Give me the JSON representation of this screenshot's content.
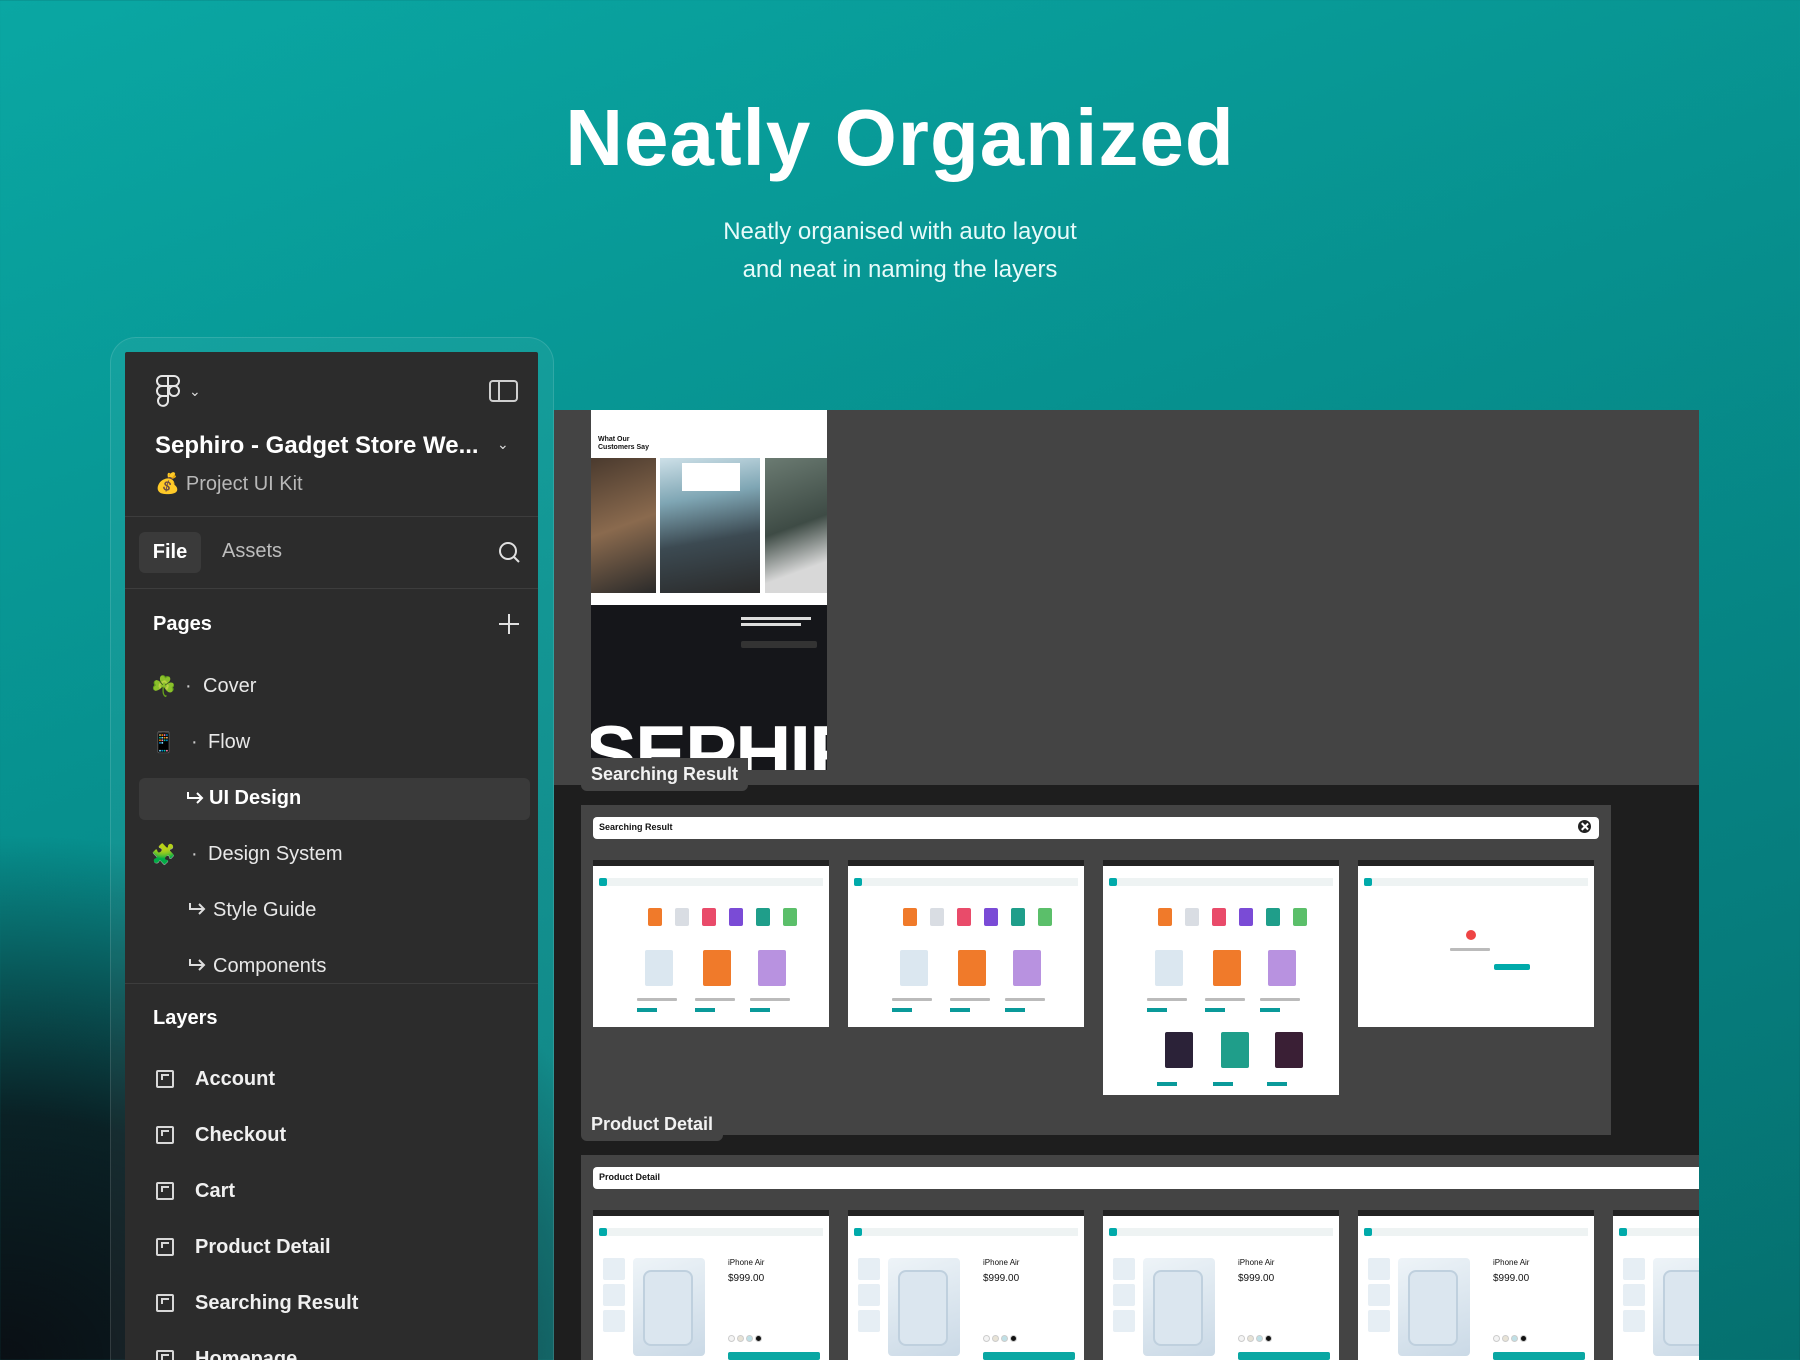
{
  "hero": {
    "title": "Neatly Organized",
    "subtitle_line1": "Neatly organised with auto layout",
    "subtitle_line2": "and neat in naming the layers"
  },
  "panel": {
    "project_title": "Sephiro - Gadget Store We...",
    "project_subtitle": "Project UI Kit",
    "tabs": {
      "file": "File",
      "assets": "Assets"
    },
    "pages_header": "Pages",
    "pages": [
      {
        "emoji": "☘️",
        "label": "Cover"
      },
      {
        "emoji": "📱",
        "label": "Flow"
      },
      {
        "label": "UI Design",
        "active": true
      },
      {
        "emoji": "🧩",
        "label": "Design System"
      },
      {
        "label": "Style Guide"
      },
      {
        "label": "Components"
      }
    ],
    "layers_header": "Layers",
    "layers": [
      "Account",
      "Checkout",
      "Cart",
      "Product Detail",
      "Searching Result",
      "Homepage"
    ]
  },
  "canvas": {
    "mock_heading_line1": "What Our",
    "mock_heading_line2": "Customers Say",
    "mock_brand": "SEPHIRO",
    "section_searching_label": "Searching Result",
    "searching_bar": "Searching Result",
    "section_product_label": "Product Detail",
    "product_bar": "Product Detail",
    "product_name": "iPhone Air",
    "product_price": "$999.00"
  },
  "colors": {
    "accent": "#0aa7a3",
    "panel_bg": "#2c2c2c",
    "canvas_bg": "#1e1e1e",
    "section_bg": "#444444"
  }
}
